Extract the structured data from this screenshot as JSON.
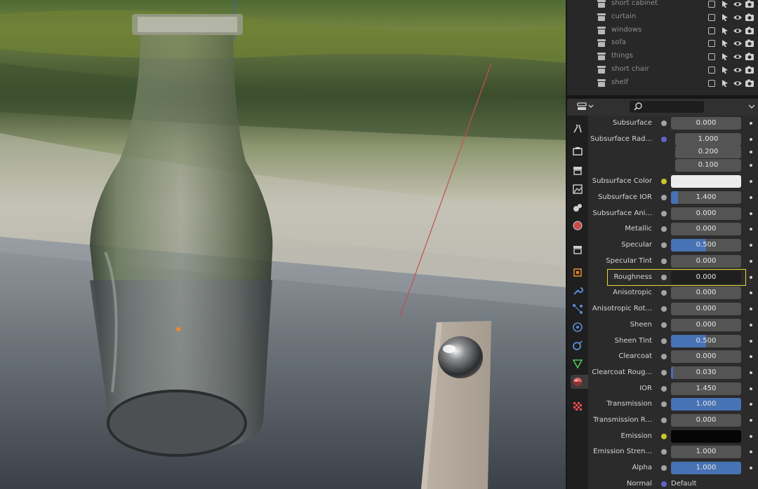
{
  "outliner": {
    "items": [
      {
        "label": "short cabinet"
      },
      {
        "label": "curtain"
      },
      {
        "label": "windows"
      },
      {
        "label": "sofa"
      },
      {
        "label": "things"
      },
      {
        "label": "short chair"
      },
      {
        "label": "shelf"
      }
    ]
  },
  "properties": {
    "search_placeholder": "",
    "rows": [
      {
        "label": "Subsurface",
        "value": "0.000",
        "fill": 0,
        "socket": "grey"
      },
      {
        "label": "Subsurface Rad...",
        "value": "1.000",
        "fill": 0,
        "socket": "blue",
        "indent": true
      },
      {
        "label": "",
        "value": "0.200",
        "fill": 0,
        "socket": "none",
        "indent": true
      },
      {
        "label": "",
        "value": "0.100",
        "fill": 0,
        "socket": "none",
        "indent": true
      },
      {
        "label": "Subsurface Color",
        "value": "",
        "fill": 0,
        "socket": "yellow",
        "swatch": "#ececec"
      },
      {
        "label": "Subsurface IOR",
        "value": "1.400",
        "fill": 0.1,
        "socket": "grey"
      },
      {
        "label": "Subsurface Ani...",
        "value": "0.000",
        "fill": 0,
        "socket": "grey"
      },
      {
        "label": "Metallic",
        "value": "0.000",
        "fill": 0,
        "socket": "grey"
      },
      {
        "label": "Specular",
        "value": "0.500",
        "fill": 0.5,
        "socket": "grey"
      },
      {
        "label": "Specular Tint",
        "value": "0.000",
        "fill": 0,
        "socket": "grey"
      },
      {
        "label": "Roughness",
        "value": "0.000",
        "fill": 0,
        "socket": "grey",
        "active": true
      },
      {
        "label": "Anisotropic",
        "value": "0.000",
        "fill": 0,
        "socket": "grey"
      },
      {
        "label": "Anisotropic Rot...",
        "value": "0.000",
        "fill": 0,
        "socket": "grey"
      },
      {
        "label": "Sheen",
        "value": "0.000",
        "fill": 0,
        "socket": "grey"
      },
      {
        "label": "Sheen Tint",
        "value": "0.500",
        "fill": 0.5,
        "socket": "grey"
      },
      {
        "label": "Clearcoat",
        "value": "0.000",
        "fill": 0,
        "socket": "grey"
      },
      {
        "label": "Clearcoat Roug...",
        "value": "0.030",
        "fill": 0.03,
        "socket": "grey"
      },
      {
        "label": "IOR",
        "value": "1.450",
        "fill": 0,
        "socket": "grey"
      },
      {
        "label": "Transmission",
        "value": "1.000",
        "fill": 1,
        "socket": "grey"
      },
      {
        "label": "Transmission R...",
        "value": "0.000",
        "fill": 0,
        "socket": "grey"
      },
      {
        "label": "Emission",
        "value": "",
        "fill": 0,
        "socket": "yellow",
        "swatch": "#050505"
      },
      {
        "label": "Emission Stren...",
        "value": "1.000",
        "fill": 0,
        "socket": "grey"
      },
      {
        "label": "Alpha",
        "value": "1.000",
        "fill": 1,
        "socket": "grey"
      },
      {
        "label": "Normal",
        "value": "Default",
        "fill": 0,
        "socket": "blue",
        "link": true
      }
    ]
  },
  "colors": {
    "accent": "#4772b3",
    "highlight": "#e4d831",
    "field": "#545454"
  }
}
